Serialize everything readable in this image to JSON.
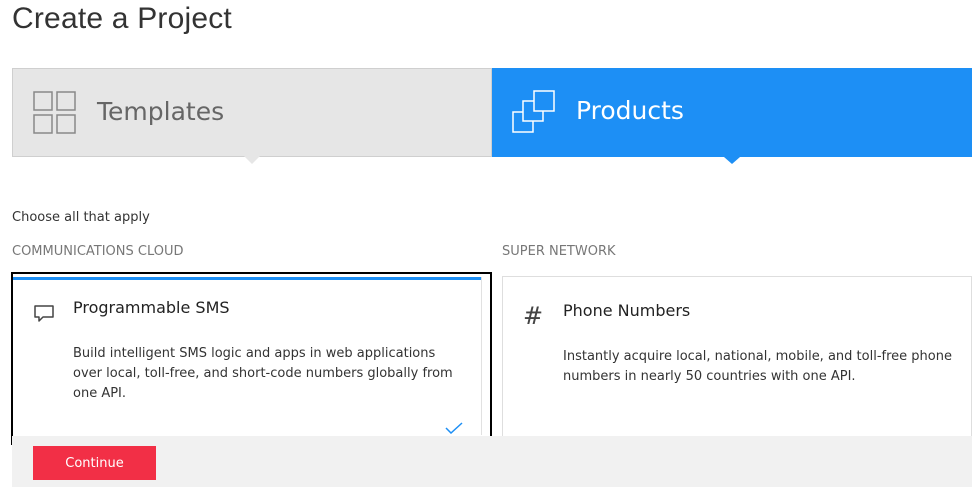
{
  "page": {
    "title": "Create a Project"
  },
  "tabs": [
    {
      "label": "Templates",
      "icon": "grid-icon",
      "active": false
    },
    {
      "label": "Products",
      "icon": "stacked-squares-icon",
      "active": true
    }
  ],
  "instructions": "Choose all that apply",
  "sections": [
    {
      "label": "COMMUNICATIONS CLOUD",
      "cards": [
        {
          "title": "Programmable SMS",
          "icon": "chat-bubble-icon",
          "description": "Build intelligent SMS logic and apps in web applications over local, toll-free, and short-code numbers globally from one API.",
          "selected": true
        }
      ]
    },
    {
      "label": "SUPER NETWORK",
      "cards": [
        {
          "title": "Phone Numbers",
          "icon": "hash-icon",
          "description": "Instantly acquire local, national, mobile, and toll-free phone numbers in nearly 50 countries with one API.",
          "selected": false
        }
      ]
    }
  ],
  "footer": {
    "continue_label": "Continue"
  },
  "colors": {
    "accent": "#1d8ff5",
    "button": "#f22f46",
    "tab_inactive": "#e6e6e6"
  }
}
